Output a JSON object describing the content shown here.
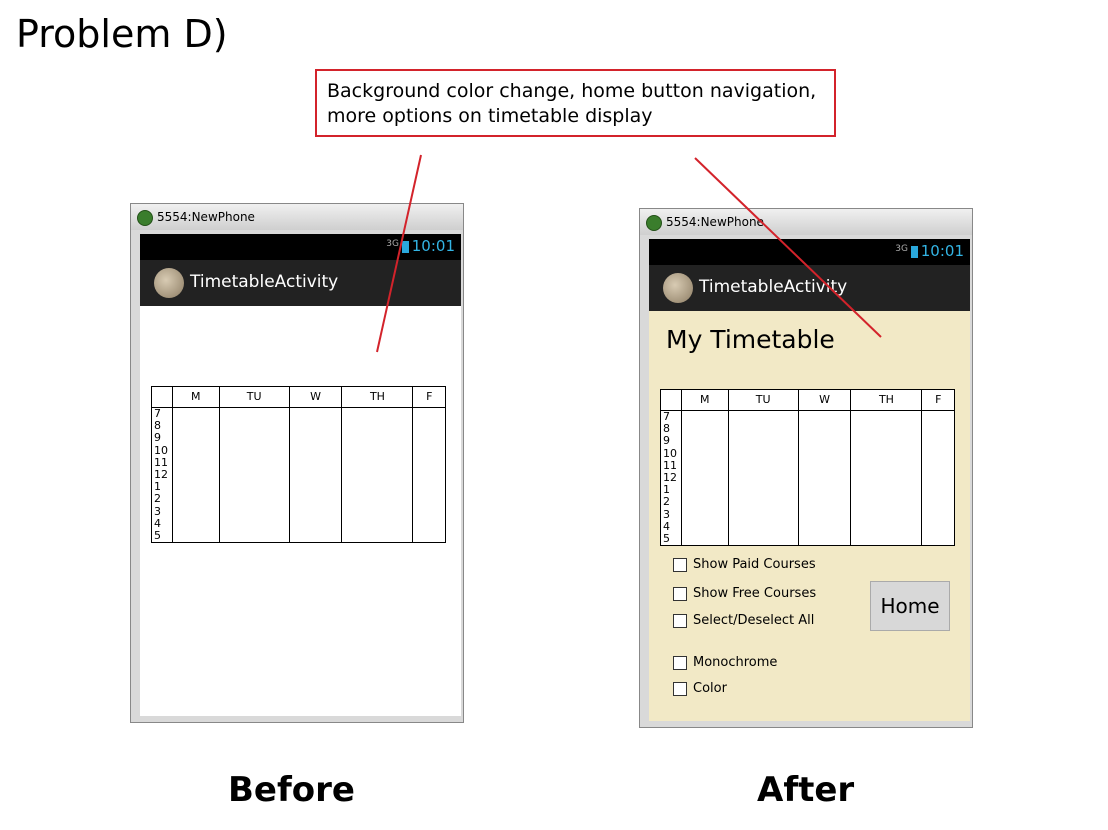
{
  "heading": "Problem D)",
  "callout": {
    "line1": "Background color change, home button navigation,",
    "line2": "more options on timetable display"
  },
  "captions": {
    "before": "Before",
    "after": "After"
  },
  "emulator": {
    "window_title": "5554:NewPhone",
    "network": "3G",
    "time": "10:01",
    "app_title": "TimetableActivity"
  },
  "timetable": {
    "days": [
      "M",
      "TU",
      "W",
      "TH",
      "F"
    ],
    "hours": [
      "7",
      "8",
      "9",
      "10",
      "11",
      "12",
      "1",
      "2",
      "3",
      "4",
      "5"
    ]
  },
  "after_screen": {
    "title": "My Timetable",
    "checkboxes": [
      "Show Paid Courses",
      "Show Free Courses",
      "Select/Deselect All",
      "Monochrome",
      "Color"
    ],
    "home_button": "Home",
    "background_color": "#f2e9c6"
  },
  "colors": {
    "callout_border": "#d3232b",
    "arrow": "#d3232b",
    "clock": "#33b5e5"
  }
}
